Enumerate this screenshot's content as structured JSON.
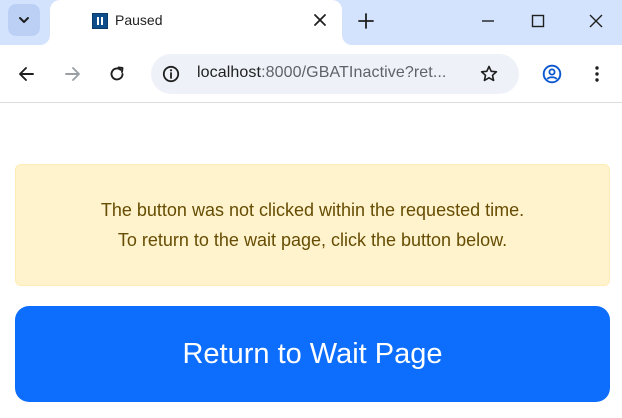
{
  "browser": {
    "tab": {
      "title": "Paused"
    },
    "address_bar": {
      "host": "localhost",
      "path": ":8000/GBATInactive?ret..."
    }
  },
  "page": {
    "alert": {
      "line1": "The button was not clicked within the requested time.",
      "line2": "To return to the wait page, click the button below."
    },
    "return_button_label": "Return to Wait Page"
  },
  "colors": {
    "tabstrip": "#d3e3fd",
    "alert_bg": "#fff3cd",
    "alert_text": "#664d03",
    "button": "#0d6efd",
    "favicon": "#0e4d8a"
  }
}
